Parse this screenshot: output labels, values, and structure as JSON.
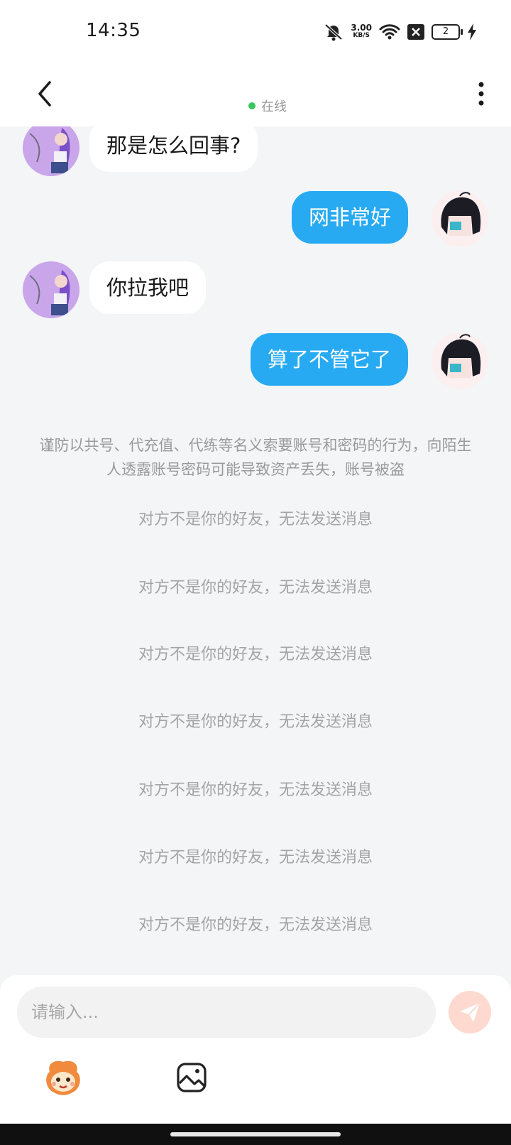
{
  "status_bar": {
    "time": "14:35",
    "net_speed_value": "3.00",
    "net_speed_unit": "KB/S",
    "battery_level": "2",
    "icons": [
      "mute-bell-icon",
      "wifi-icon",
      "sim-x-icon",
      "battery-icon",
      "charging-icon"
    ]
  },
  "header": {
    "status_text": "在线",
    "icons": [
      "back-arrow-icon",
      "more-vertical-icon"
    ]
  },
  "messages": [
    {
      "from": "other",
      "text": "那是怎么回事?"
    },
    {
      "from": "me",
      "text": "网非常好"
    },
    {
      "from": "other",
      "text": "你拉我吧"
    },
    {
      "from": "me",
      "text": "算了不管它了"
    }
  ],
  "security_notice": "谨防以共号、代充值、代练等名义索要账号和密码的行为，向陌生人透露账号密码可能导致资产丢失，账号被盗",
  "system_messages": [
    "对方不是你的好友，无法发送消息",
    "对方不是你的好友，无法发送消息",
    "对方不是你的好友，无法发送消息",
    "对方不是你的好友，无法发送消息",
    "对方不是你的好友，无法发送消息",
    "对方不是你的好友，无法发送消息",
    "对方不是你的好友，无法发送消息"
  ],
  "composer": {
    "placeholder": "请输入...",
    "icons": [
      "send-icon",
      "mascot-sticker-icon",
      "image-icon"
    ]
  },
  "colors": {
    "outgoing_bubble": "#27aaf2",
    "online_dot": "#39c75d",
    "send_button": "#fdd9cf"
  }
}
